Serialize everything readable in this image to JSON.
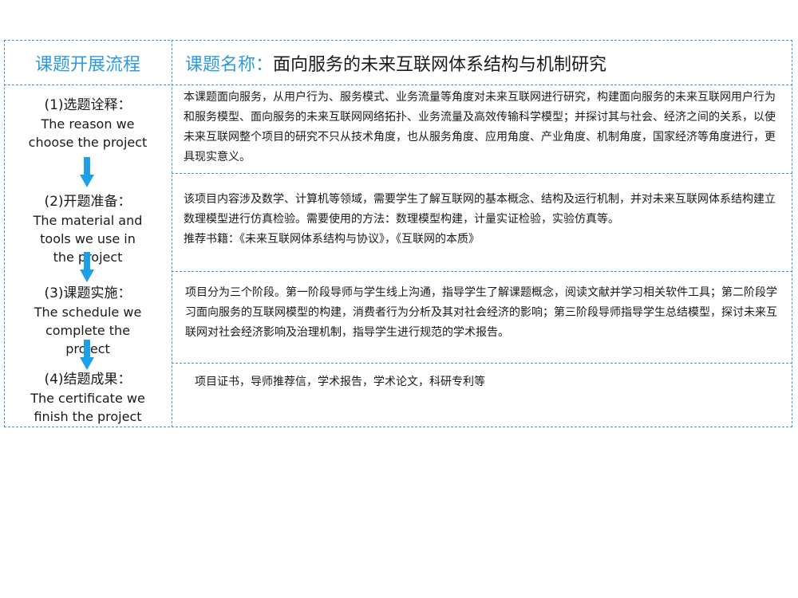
{
  "header": {
    "left_title": "课题开展流程",
    "right_label": "课题名称：",
    "right_title": "面向服务的未来互联网体系结构与机制研究"
  },
  "steps": [
    {
      "title": "(1)选题诠释：",
      "subtitle": "The reason we choose the project"
    },
    {
      "title": "(2)开题准备：",
      "subtitle": "The material and tools we use in the project"
    },
    {
      "title": "(3)课题实施：",
      "subtitle": "The schedule we complete the project"
    },
    {
      "title": "(4)结题成果：",
      "subtitle": "The certificate we finish the project"
    }
  ],
  "descriptions": [
    {
      "text": "本课题面向服务，从用户行为、服务模式、业务流量等角度对未来互联网进行研究，构建面向服务的未来互联网用户行为和服务模型、面向服务的未来互联网网络拓扑、业务流量及高效传输科学模型；并探讨其与社会、经济之间的关系，以使未来互联网整个项目的研究不只从技术角度，也从服务角度、应用角度、产业角度、机制角度，国家经济等角度进行，更具现实意义。"
    },
    {
      "text": "该项目内容涉及数学、计算机等领域，需要学生了解互联网的基本概念、结构及运行机制，并对未来互联网体系结构建立数理模型进行仿真检验。需要使用的方法：数理模型构建，计量实证检验，实验仿真等。",
      "books": "推荐书籍：《未来互联网体系结构与协议》，《互联网的本质》"
    },
    {
      "text": "项目分为三个阶段。第一阶段导师与学生线上沟通，指导学生了解课题概念，阅读文献并学习相关软件工具；第二阶段学习面向服务的互联网模型的构建，消费者行为分析及其对社会经济的影响；第三阶段导师指导学生总结模型，探讨未来互联网对社会经济影响及治理机制，指导学生进行规范的学术报告。"
    },
    {
      "text": "项目证书，导师推荐信，学术报告，学术论文，科研专利等"
    }
  ],
  "colors": {
    "accent": "#2e9be0",
    "border": "#3b95d8",
    "arrow": "#1ea0e6"
  },
  "icons": {
    "arrow": "arrow-down-icon"
  }
}
